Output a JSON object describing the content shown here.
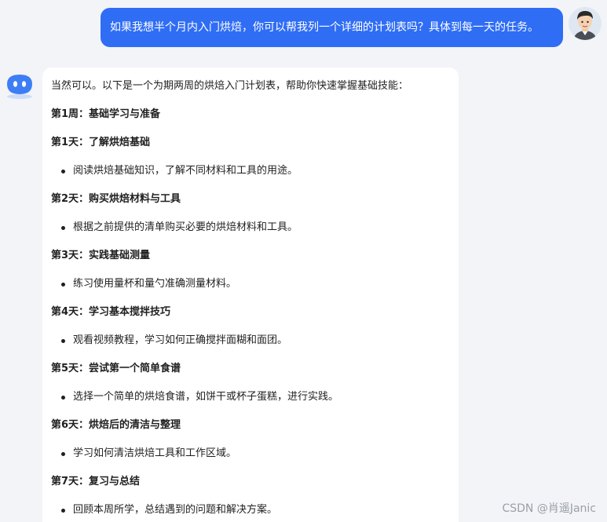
{
  "user_message": {
    "text": "如果我想半个月内入门烘焙，你可以帮我列一个详细的计划表吗？具体到每一天的任务。"
  },
  "bot_message": {
    "intro": "当然可以。以下是一个为期两周的烘焙入门计划表，帮助你快速掌握基础技能：",
    "week_title": "第1周：基础学习与准备",
    "days": [
      {
        "title": "第1天：了解烘焙基础",
        "task": "阅读烘焙基础知识，了解不同材料和工具的用途。"
      },
      {
        "title": "第2天：购买烘焙材料与工具",
        "task": "根据之前提供的清单购买必要的烘焙材料和工具。"
      },
      {
        "title": "第3天：实践基础测量",
        "task": "练习使用量杯和量勺准确测量材料。"
      },
      {
        "title": "第4天：学习基本搅拌技巧",
        "task": "观看视频教程，学习如何正确搅拌面糊和面团。"
      },
      {
        "title": "第5天：尝试第一个简单食谱",
        "task": "选择一个简单的烘焙食谱，如饼干或杯子蛋糕，进行实践。"
      },
      {
        "title": "第6天：烘焙后的清洁与整理",
        "task": "学习如何清洁烘焙工具和工作区域。"
      },
      {
        "title": "第7天：复习与总结",
        "task": "回顾本周所学，总结遇到的问题和解决方案。"
      }
    ]
  },
  "watermark": "CSDN @肖遥Janic",
  "colors": {
    "user_bubble": "#2f6df5",
    "bot_bubble": "#ffffff",
    "background": "#f3f4f8",
    "bot_avatar": "#3d7ef6"
  },
  "icons": {
    "user_avatar": "cartoon-man-avatar-icon",
    "bot_avatar": "robot-chat-icon"
  }
}
